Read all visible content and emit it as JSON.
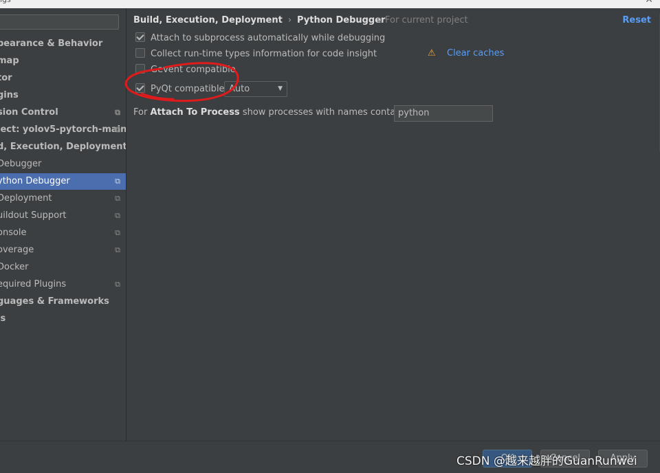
{
  "window": {
    "title": "ngs"
  },
  "sidebar": {
    "search_value": "",
    "items": [
      {
        "label": "pearance & Behavior",
        "bold": true,
        "project": false
      },
      {
        "label": "map",
        "bold": true,
        "project": false
      },
      {
        "label": "tor",
        "bold": true,
        "project": false
      },
      {
        "label": "gins",
        "bold": true,
        "project": false
      },
      {
        "label": "sion Control",
        "bold": true,
        "project": true
      },
      {
        "label": "ject: yolov5-pytorch-main",
        "bold": true,
        "project": true
      },
      {
        "label": "d, Execution, Deployment",
        "bold": true,
        "project": false
      },
      {
        "label": "Debugger",
        "bold": false,
        "project": false
      },
      {
        "label": "ython Debugger",
        "bold": false,
        "project": true,
        "selected": true
      },
      {
        "label": "Deployment",
        "bold": false,
        "project": true
      },
      {
        "label": "uildout Support",
        "bold": false,
        "project": true
      },
      {
        "label": "onsole",
        "bold": false,
        "project": true
      },
      {
        "label": "overage",
        "bold": false,
        "project": true
      },
      {
        "label": "Docker",
        "bold": false,
        "project": false
      },
      {
        "label": "equired Plugins",
        "bold": false,
        "project": true
      },
      {
        "label": "guages & Frameworks",
        "bold": true,
        "project": false
      },
      {
        "label": "ls",
        "bold": true,
        "project": false
      }
    ]
  },
  "header": {
    "breadcrumb_parent": "Build, Execution, Deployment",
    "breadcrumb_sep": "›",
    "breadcrumb_current": "Python Debugger",
    "scope_label": "For current project",
    "reset_label": "Reset"
  },
  "options": {
    "attach_subprocess": {
      "label": "Attach to subprocess automatically while debugging",
      "checked": true
    },
    "collect_types": {
      "label": "Collect run-time types information for code insight",
      "checked": false
    },
    "clear_caches_label": "Clear caches",
    "gevent": {
      "label": "Gevent compatible",
      "checked": false
    },
    "pyqt": {
      "label": "PyQt compatible",
      "checked": true
    },
    "pyqt_mode": "Auto"
  },
  "attach_to_process": {
    "prefix": "For",
    "bold": "Attach To Process",
    "suffix": "show processes with names containing:",
    "value": "python"
  },
  "footer": {
    "ok_label": "OK",
    "cancel_label": "Cancel",
    "apply_label": "Apply"
  },
  "watermark": "CSDN @越来越胖的GuanRunwei",
  "icons": {
    "project_scope": "copy-icon",
    "warning": "warning-triangle-icon",
    "dropdown": "chevron-down-icon"
  },
  "colors": {
    "background": "#3c3f41",
    "selection": "#4b6eaf",
    "link": "#589df6",
    "warning": "#f0a732",
    "annotation": "#e01b1b"
  }
}
